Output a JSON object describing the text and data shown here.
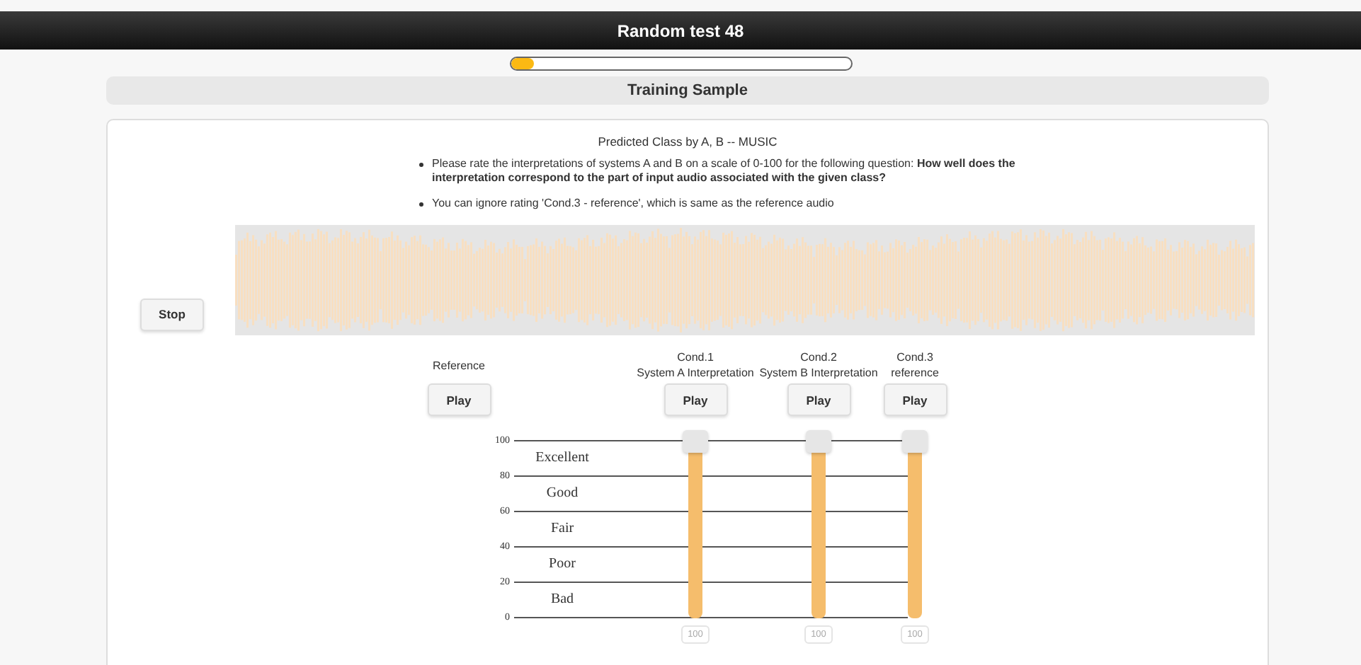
{
  "header": {
    "title": "Random test 48"
  },
  "progress": {
    "level": 0.07
  },
  "section": {
    "title": "Training Sample"
  },
  "instructions": {
    "title": "Predicted Class by A, B -- MUSIC",
    "bullets": [
      "Please rate the interpretations of systems A and B on a scale of 0-100 for the following question: **How well does the interpretation correspond to the part of input audio associated with the given class?**",
      "You can ignore rating 'Cond.3 - reference', which is same as the reference audio"
    ]
  },
  "player": {
    "stop_button": "Stop"
  },
  "reference": {
    "label": "Reference",
    "button": "Play"
  },
  "scale": {
    "ticks": [
      "100",
      "80",
      "60",
      "40",
      "20",
      "0"
    ],
    "categories": [
      "Excellent",
      "Good",
      "Fair",
      "Poor",
      "Bad"
    ]
  },
  "conditions": [
    {
      "name": "Cond.1",
      "subtitle": "System A Interpretation",
      "button": "Play",
      "value": "100"
    },
    {
      "name": "Cond.2",
      "subtitle": "System B Interpretation",
      "button": "Play",
      "value": "100"
    },
    {
      "name": "Cond.3",
      "subtitle": "reference",
      "button": "Play",
      "value": "100"
    }
  ]
}
